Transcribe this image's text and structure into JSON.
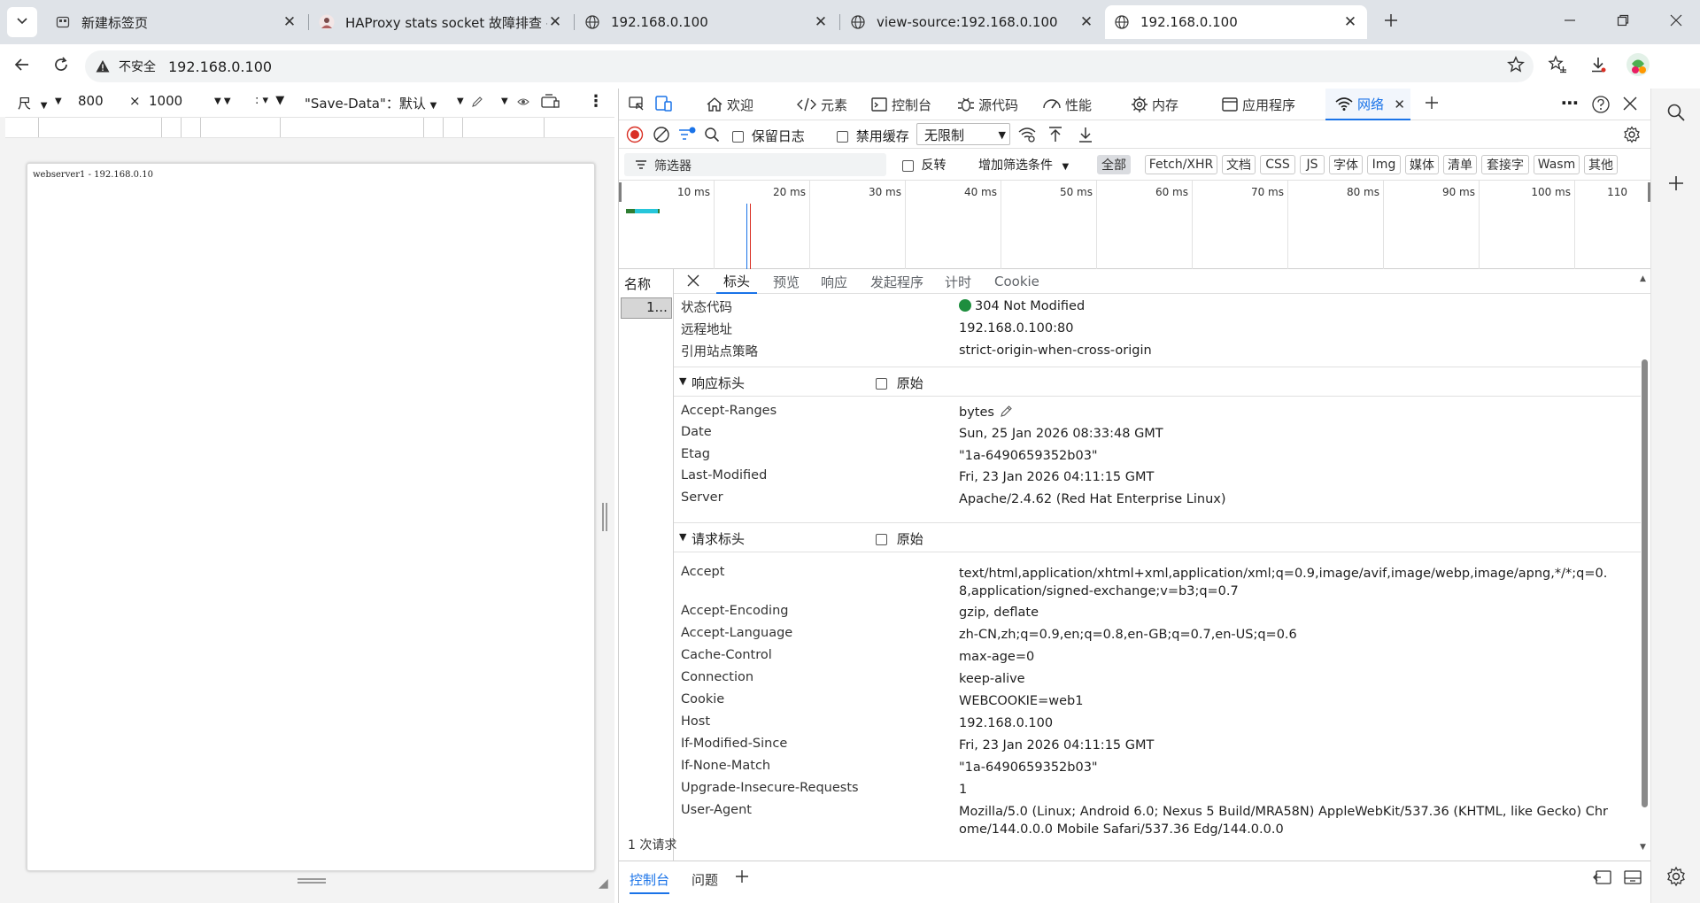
{
  "browser": {
    "tabs": [
      {
        "title": "新建标签页",
        "icon": "new-tab-icon"
      },
      {
        "title": "HAProxy stats socket 故障排查 - 王",
        "icon": "avatar-icon"
      },
      {
        "title": "192.168.0.100",
        "icon": "globe-icon"
      },
      {
        "title": "view-source:192.168.0.100",
        "icon": "globe-icon"
      },
      {
        "title": "192.168.0.100",
        "icon": "globe-icon"
      }
    ],
    "security_label": "不安全",
    "url": "192.168.0.100"
  },
  "device_toolbar": {
    "dimension_label": "尺",
    "width": "800",
    "times": "×",
    "height": "1000",
    "save_data": "\"Save-Data\"：默认"
  },
  "page": {
    "content": "webserver1 - 192.168.0.10"
  },
  "devtools": {
    "tabs": [
      {
        "label": "欢迎",
        "icon": "home-icon"
      },
      {
        "label": "元素",
        "icon": "code-icon"
      },
      {
        "label": "控制台",
        "icon": "console-icon"
      },
      {
        "label": "源代码",
        "icon": "bug-icon"
      },
      {
        "label": "性能",
        "icon": "performance-icon"
      },
      {
        "label": "内存",
        "icon": "memory-icon"
      },
      {
        "label": "应用程序",
        "icon": "application-icon"
      },
      {
        "label": "网络",
        "icon": "wifi-icon"
      }
    ],
    "network_toolbar": {
      "preserve_log": "保留日志",
      "disable_cache": "禁用缓存",
      "throttle": "无限制"
    },
    "filter_row": {
      "placeholder": "筛选器",
      "invert": "反转",
      "more_filters": "增加筛选条件",
      "chips": [
        "全部",
        "Fetch/XHR",
        "文档",
        "CSS",
        "JS",
        "字体",
        "Img",
        "媒体",
        "清单",
        "套接字",
        "Wasm",
        "其他"
      ]
    },
    "timeline_labels": [
      "10 ms",
      "20 ms",
      "30 ms",
      "40 ms",
      "50 ms",
      "60 ms",
      "70 ms",
      "80 ms",
      "90 ms",
      "100 ms",
      "110"
    ],
    "name_column": {
      "header": "名称",
      "row": "1...",
      "footer": "1 次请求"
    },
    "detail_tabs": [
      "标头",
      "预览",
      "响应",
      "发起程序",
      "计时",
      "Cookie"
    ],
    "general": [
      {
        "key": "状态代码",
        "value": "304 Not Modified"
      },
      {
        "key": "远程地址",
        "value": "192.168.0.100:80"
      },
      {
        "key": "引用站点策略",
        "value": "strict-origin-when-cross-origin"
      }
    ],
    "response_headers_title": "响应标头",
    "raw_label": "原始",
    "response_headers": [
      {
        "key": "Accept-Ranges",
        "value": "bytes"
      },
      {
        "key": "Date",
        "value": "Sun, 25 Jan 2026 08:33:48 GMT"
      },
      {
        "key": "Etag",
        "value": "\"1a-6490659352b03\""
      },
      {
        "key": "Last-Modified",
        "value": "Fri, 23 Jan 2026 04:11:15 GMT"
      },
      {
        "key": "Server",
        "value": "Apache/2.4.62 (Red Hat Enterprise Linux)"
      }
    ],
    "request_headers_title": "请求标头",
    "request_headers": [
      {
        "key": "Accept",
        "value": "text/html,application/xhtml+xml,application/xml;q=0.9,image/avif,image/webp,image/apng,*/*;q=0.8,application/signed-exchange;v=b3;q=0.7"
      },
      {
        "key": "Accept-Encoding",
        "value": "gzip, deflate"
      },
      {
        "key": "Accept-Language",
        "value": "zh-CN,zh;q=0.9,en;q=0.8,en-GB;q=0.7,en-US;q=0.6"
      },
      {
        "key": "Cache-Control",
        "value": "max-age=0"
      },
      {
        "key": "Connection",
        "value": "keep-alive"
      },
      {
        "key": "Cookie",
        "value": "WEBCOOKIE=web1"
      },
      {
        "key": "Host",
        "value": "192.168.0.100"
      },
      {
        "key": "If-Modified-Since",
        "value": "Fri, 23 Jan 2026 04:11:15 GMT"
      },
      {
        "key": "If-None-Match",
        "value": "\"1a-6490659352b03\""
      },
      {
        "key": "Upgrade-Insecure-Requests",
        "value": "1"
      },
      {
        "key": "User-Agent",
        "value": "Mozilla/5.0 (Linux; Android 6.0; Nexus 5 Build/MRA58N) AppleWebKit/537.36 (KHTML, like Gecko) Chrome/144.0.0.0 Mobile Safari/537.36 Edg/144.0.0.0"
      }
    ],
    "drawer_tabs": [
      "控制台",
      "问题"
    ]
  },
  "colors": {
    "accent": "#1a73e8",
    "status_ok": "#1e8e3e",
    "record": "#d93025"
  }
}
